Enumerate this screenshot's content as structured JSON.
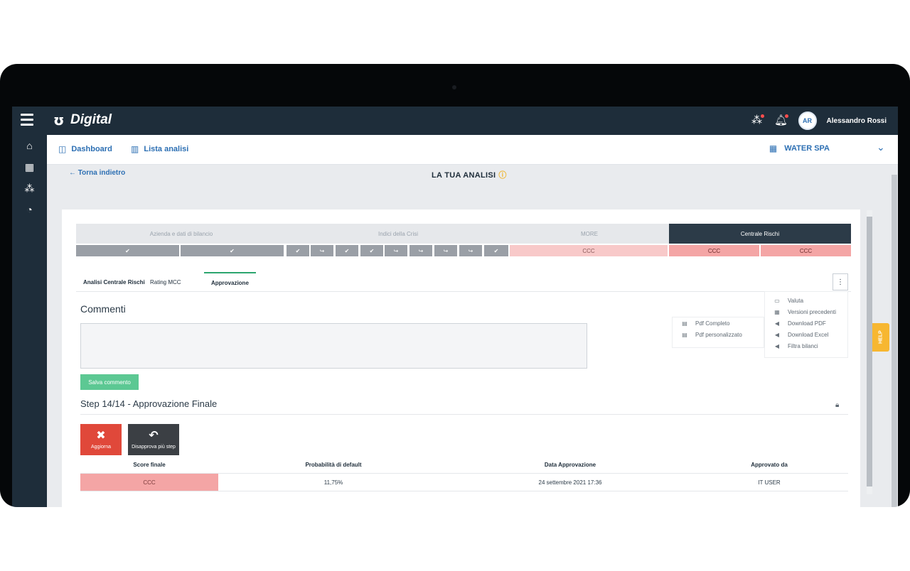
{
  "app": {
    "brand": "Digital",
    "user_initials": "AR",
    "user_name": "Alessandro Rossi"
  },
  "nav": {
    "dashboard": "Dashboard",
    "lista": "Lista analisi",
    "company": "WATER SPA"
  },
  "page": {
    "back": "← Torna indietro",
    "title": "LA TUA ANALISI"
  },
  "stepper": {
    "stages": [
      "Azienda e dati di bilancio",
      "Indici della Crisi",
      "MORE",
      "Centrale Rischi"
    ],
    "more_status": "CCC",
    "cr_status_1": "CCC",
    "cr_status_2": "CCC"
  },
  "tabs": [
    "Analisi Centrale Rischi",
    "Rating MCC",
    "Approvazione"
  ],
  "comments": {
    "title": "Commenti",
    "save_label": "Salva commento"
  },
  "pdf_menu": [
    "Pdf Completo",
    "Pdf personalizzato"
  ],
  "actions_menu": [
    "Valuta",
    "Versioni precedenti",
    "Download PDF",
    "Download Excel",
    "Filtra bilanci"
  ],
  "step": {
    "title": "Step 14/14 - Approvazione Finale",
    "btn_update": "Aggiorna",
    "btn_disapprove": "Disapprova più step"
  },
  "table": {
    "headers": [
      "Score finale",
      "Probabilità di default",
      "Data Approvazione",
      "Approvato da"
    ],
    "row": [
      "CCC",
      "11,75%",
      "24 settembre 2021 17:36",
      "IT USER"
    ]
  },
  "help_label": "HELP",
  "colors": {
    "primary": "#2c6fb3",
    "dark": "#1e2d3a",
    "success": "#5cc893",
    "danger": "#e0483a",
    "score_bg": "#f4a5a5",
    "help": "#f7b731"
  }
}
